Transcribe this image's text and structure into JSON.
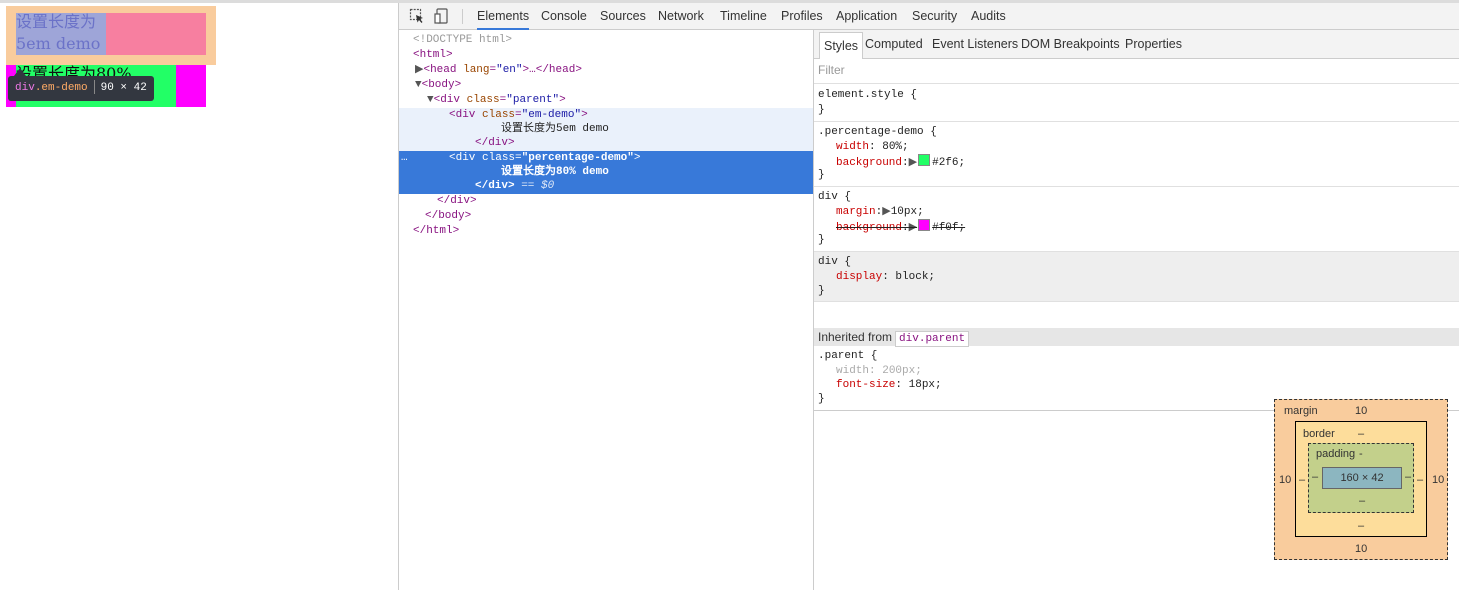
{
  "preview": {
    "em_demo_text": "设置长度为\n5em demo",
    "percentage_demo_text": "设置长度为80%\ndemo",
    "tooltip": {
      "tag": "div",
      "class_name": ".em-demo",
      "size": "90 × 42"
    },
    "colors": {
      "margin": "#f9cc9d",
      "em_content": "#9ea5d8",
      "parent_bg": "#f0f",
      "percentage_bg": "#2f6"
    }
  },
  "toolbar": {
    "icons": [
      "inspect-icon",
      "device-mode-icon"
    ],
    "tabs": [
      "Elements",
      "Console",
      "Sources",
      "Network",
      "Timeline",
      "Profiles",
      "Application",
      "Security",
      "Audits"
    ],
    "active_tab": "Elements"
  },
  "dom": {
    "doctype": "<!DOCTYPE html>",
    "html_open": "<html>",
    "head_tag": "<head",
    "head_attr": "lang",
    "head_val": "\"en\"",
    "head_rest": ">…</head>",
    "body_open": "<body>",
    "parent_open_tag": "<div",
    "parent_attr": "class",
    "parent_val": "\"parent\"",
    "em_open_tag": "<div",
    "em_attr": "class",
    "em_val": "\"em-demo\"",
    "em_text": "设置长度为5em demo",
    "div_close": "</div>",
    "pct_open_tag": "<div",
    "pct_attr": "class",
    "pct_val": "\"percentage-demo\"",
    "pct_text": "设置长度为80% demo",
    "pct_close": "</div>",
    "eq_marker": " == $0",
    "ellipsis": "…",
    "parent_close": "</div>",
    "body_close": "</body>",
    "html_close": "</html>"
  },
  "styles_tabs": [
    "Styles",
    "Computed",
    "Event Listeners",
    "DOM Breakpoints",
    "Properties"
  ],
  "filter_placeholder": "Filter",
  "rules": {
    "element_style": {
      "selector": "element.style {",
      "close": "}"
    },
    "percentage_demo": {
      "selector": ".percentage-demo {",
      "width_prop": "width",
      "width_val": "80%;",
      "bg_prop": "background",
      "bg_val": "#2f6;",
      "bg_color": "#2f6",
      "close": "}"
    },
    "div_margin": {
      "selector": "div {",
      "margin_prop": "margin",
      "margin_val": "10px;",
      "bg_prop": "background",
      "bg_val": "#f0f;",
      "bg_color": "#f0f",
      "close": "}"
    },
    "div_display": {
      "selector": "div {",
      "display_prop": "display",
      "display_val": "block;",
      "close": "}"
    },
    "inherited_label": "Inherited from",
    "inherited_chip": "div.parent",
    "parent": {
      "selector": ".parent {",
      "width_prop": "width",
      "width_val": "200px;",
      "font_prop": "font-size",
      "font_val": "18px;",
      "close": "}"
    }
  },
  "box_model": {
    "margin_label": "margin",
    "margin_top": "10",
    "margin_bottom": "10",
    "margin_left": "10",
    "margin_right": "10",
    "border_label": "border",
    "border_top": "–",
    "border_bottom": "–",
    "border_left": "–",
    "border_right": "–",
    "padding_label": "padding",
    "padding_top": "-",
    "padding_bottom": "–",
    "padding_left": "–",
    "padding_right": "–",
    "content": "160 × 42"
  }
}
